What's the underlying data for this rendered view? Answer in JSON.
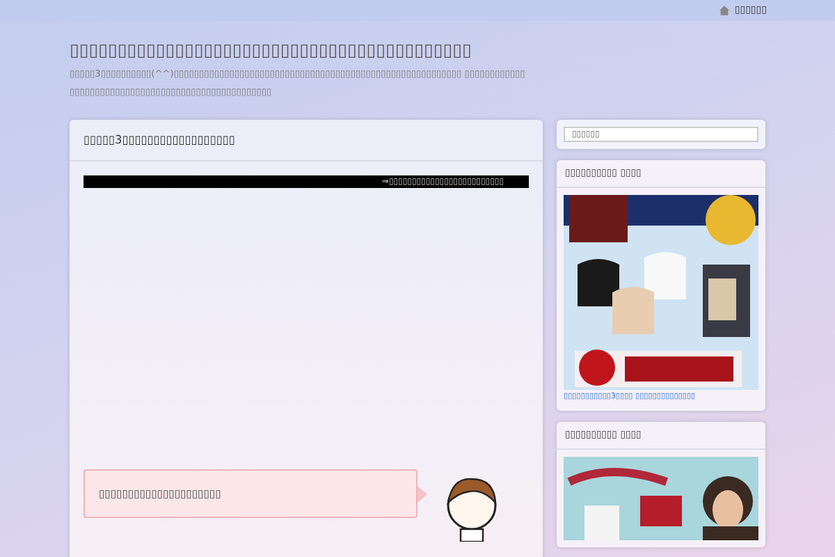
{
  "top_link": "▯▯▯▯▯▯",
  "site": {
    "title": "▯▯▯▯▯▯▯▯▯▯▯▯▯▯▯▯▯▯▯▯▯▯▯▯▯▯▯▯▯▯▯▯▯▯▯▯▯▯▯▯▯▯",
    "description": "▯▯▯▯▯3▯▯▯▯▯▯▯▯▯▯(^^)▯▯▯▯▯▯▯▯▯▯▯▯▯▯▯▯▯▯▯▯▯▯▯▯▯▯▯▯▯▯▯▯▯▯▯▯▯▯▯▯▯▯▯▯▯▯▯▯▯▯▯▯▯▯▯▯▯ ▯▯▯▯▯▯▯▯▯▯▯▯ ▯▯▯▯▯▯▯▯▯▯▯▯▯▯▯▯▯▯▯▯▯▯▯▯▯▯▯▯▯▯▯▯▯▯▯▯▯▯▯▯"
  },
  "post": {
    "title": "▯▯▯▯▯3▯▯▯▯▯▯▯▯▯▯▯▯▯▯▯▯▯▯",
    "banner": "⇒▯▯▯▯▯▯▯▯▯▯▯▯▯▯▯▯▯▯▯▯▯▯▯▯▯",
    "speech": "▯▯▯▯▯▯▯▯▯▯▯▯▯▯▯▯▯▯▯▯▯"
  },
  "search": {
    "placeholder": "▯▯▯▯▯▯"
  },
  "widgets": [
    {
      "title": "▯▯▯▯▯▯▯▯▯▯ ▯▯▯▯",
      "link": "▯▯▯▯▯▯▯▯▯▯▯3▯▯▯▯ ▯▯▯▯▯▯▯▯▯▯▯▯▯▯"
    },
    {
      "title": "▯▯▯▯▯▯▯▯▯▯ ▯▯▯▯"
    }
  ]
}
